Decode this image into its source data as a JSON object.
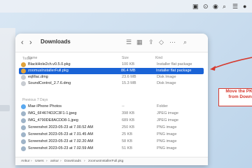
{
  "window": {
    "title": "Downloads",
    "columns": {
      "name": "Name",
      "size": "Size",
      "kind": "Kind"
    },
    "sections": {
      "today": "Today",
      "previous": "Previous 7 Days"
    },
    "today_rows": [
      {
        "name": "BlackHole2ch.v0.5.0.pkg",
        "size": "100 KB",
        "kind": "Installer flat package",
        "icon": "package-icon",
        "color": "#e2a33a"
      },
      {
        "name": "zoomusInstallerFull.pkg",
        "size": "86.4 MB",
        "kind": "Installer flat package",
        "icon": "package-icon",
        "color": "#e2a33a"
      },
      {
        "name": "eqMac.dmg",
        "size": "23.6 MB",
        "kind": "Disk Image",
        "icon": "disk-image-icon",
        "color": "#c8ccd2"
      },
      {
        "name": "SoundControl_2.7.6.dmg",
        "size": "15.3 MB",
        "kind": "Disk Image",
        "icon": "disk-image-icon",
        "color": "#c8ccd2"
      }
    ],
    "previous_rows": [
      {
        "name": "Mae iPhone Photos",
        "size": "--",
        "kind": "Folder",
        "icon": "folder-icon",
        "color": "#5aa9f0"
      },
      {
        "name": "IMG_6F4674D2C3F1-1.jpeg",
        "size": "398 KB",
        "kind": "JPEG image",
        "icon": "image-icon",
        "color": "#9fb4c8"
      },
      {
        "name": "IMG_4790DE8ACDD8-1.jpeg",
        "size": "689 KB",
        "kind": "JPEG image",
        "icon": "image-icon",
        "color": "#9fb4c8"
      },
      {
        "name": "Screenshot 2023-05-23 at 7.00.52 AM",
        "size": "250 KB",
        "kind": "PNG image",
        "icon": "image-icon",
        "color": "#9fb4c8"
      },
      {
        "name": "Screenshot 2023-05-23 at 7.01.45 AM",
        "size": "25 KB",
        "kind": "PNG image",
        "icon": "image-icon",
        "color": "#9fb4c8"
      },
      {
        "name": "Screenshot 2023-05-23 at 7.02.20 AM",
        "size": "58 KB",
        "kind": "PNG image",
        "icon": "image-icon",
        "color": "#9fb4c8"
      },
      {
        "name": "Screenshot 2023-05-23 at 7.02.59 AM",
        "size": "51 KB",
        "kind": "PNG image",
        "icon": "image-icon",
        "color": "#9fb4c8"
      }
    ],
    "path": [
      "Ankur",
      "Users",
      "ankur",
      "Downloads",
      "zoomusInstallerFull.pkg"
    ]
  },
  "callout": {
    "line1": "Move the PKG",
    "line2": "from Downl"
  },
  "accent": "#1a63d6",
  "annotation_color": "#d63a2f"
}
